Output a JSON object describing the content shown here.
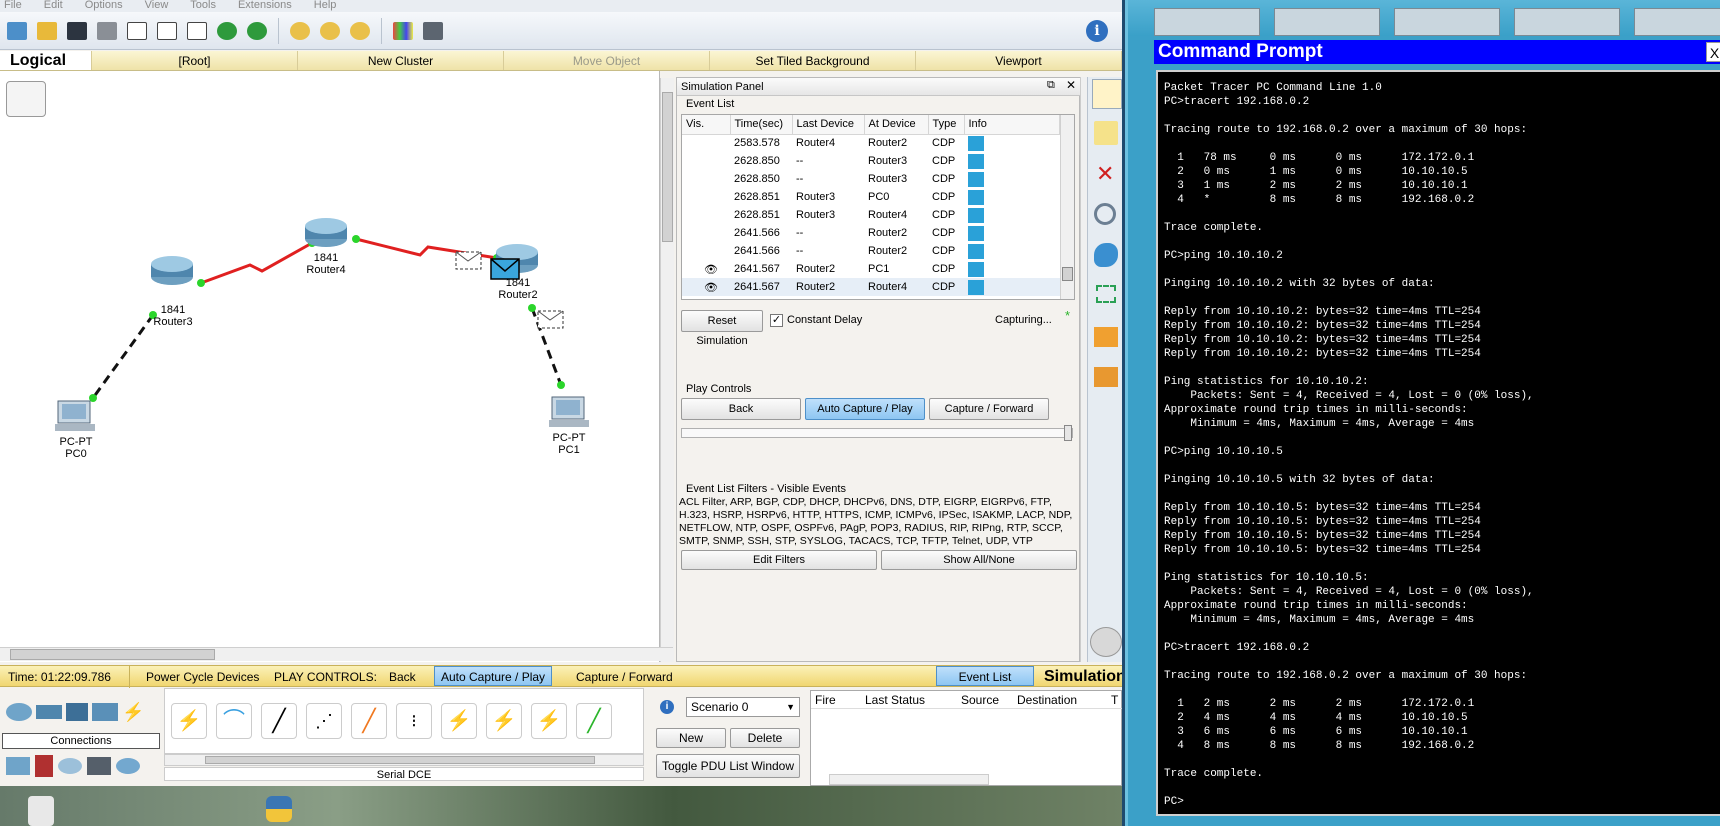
{
  "menu": [
    "File",
    "Edit",
    "Options",
    "View",
    "Tools",
    "Extensions",
    "Help"
  ],
  "logical_bar": {
    "title": "Logical",
    "items": [
      "[Root]",
      "New Cluster",
      "Move Object",
      "Set Tiled Background",
      "Viewport"
    ]
  },
  "devices": {
    "router3": {
      "model": "1841",
      "name": "Router3"
    },
    "router4": {
      "model": "1841",
      "name": "Router4"
    },
    "router2": {
      "model": "1841",
      "name": "Router2"
    },
    "pc0": {
      "model": "PC-PT",
      "name": "PC0"
    },
    "pc1": {
      "model": "PC-PT",
      "name": "PC1"
    }
  },
  "sim_panel": {
    "title": "Simulation Panel",
    "event_list_label": "Event List",
    "columns": [
      "Vis.",
      "Time(sec)",
      "Last Device",
      "At Device",
      "Type",
      "Info"
    ],
    "rows": [
      {
        "vis": "",
        "time": "2583.578",
        "last": "Router4",
        "at": "Router2",
        "type": "CDP"
      },
      {
        "vis": "",
        "time": "2628.850",
        "last": "--",
        "at": "Router3",
        "type": "CDP"
      },
      {
        "vis": "",
        "time": "2628.850",
        "last": "--",
        "at": "Router3",
        "type": "CDP"
      },
      {
        "vis": "",
        "time": "2628.851",
        "last": "Router3",
        "at": "PC0",
        "type": "CDP"
      },
      {
        "vis": "",
        "time": "2628.851",
        "last": "Router3",
        "at": "Router4",
        "type": "CDP"
      },
      {
        "vis": "",
        "time": "2641.566",
        "last": "--",
        "at": "Router2",
        "type": "CDP"
      },
      {
        "vis": "",
        "time": "2641.566",
        "last": "--",
        "at": "Router2",
        "type": "CDP"
      },
      {
        "vis": "eye",
        "time": "2641.567",
        "last": "Router2",
        "at": "PC1",
        "type": "CDP"
      },
      {
        "vis": "eye",
        "time": "2641.567",
        "last": "Router2",
        "at": "Router4",
        "type": "CDP"
      }
    ],
    "info_color": "#2aa1d8",
    "reset_label": "Reset Simulation",
    "constant_delay_label": "Constant Delay",
    "capturing_label": "Capturing...",
    "play_controls_label": "Play Controls",
    "back_label": "Back",
    "auto_label": "Auto Capture / Play",
    "forward_label": "Capture / Forward",
    "filters_label": "Event List Filters - Visible Events",
    "filters_text": "ACL Filter, ARP, BGP, CDP, DHCP, DHCPv6, DNS, DTP, EIGRP, EIGRPv6, FTP, H.323, HSRP, HSRPv6, HTTP, HTTPS, ICMP, ICMPv6, IPSec, ISAKMP, LACP, NDP, NETFLOW, NTP, OSPF, OSPFv6, PAgP, POP3, RADIUS, RIP, RIPng, RTP, SCCP, SMTP, SNMP, SSH, STP, SYSLOG, TACACS, TCP, TFTP, Telnet, UDP, VTP",
    "edit_filters_label": "Edit Filters",
    "show_all_label": "Show All/None"
  },
  "bottom_bar": {
    "time": "Time: 01:22:09.786",
    "power_cycle": "Power Cycle Devices",
    "play_controls": "PLAY CONTROLS:",
    "back": "Back",
    "auto": "Auto Capture / Play",
    "forward": "Capture / Forward",
    "event_list": "Event List",
    "mode": "Simulation"
  },
  "device_panel": {
    "connections_label": "Connections",
    "selected_conn": "Serial DCE",
    "scenario": "Scenario 0",
    "new_label": "New",
    "delete_label": "Delete",
    "toggle_label": "Toggle PDU List Window",
    "pdu_columns": [
      "Fire",
      "Last Status",
      "Source",
      "Destination",
      "T"
    ]
  },
  "cmd": {
    "title": "Command Prompt",
    "close": "X",
    "lines": [
      "Packet Tracer PC Command Line 1.0",
      "PC>tracert 192.168.0.2",
      "",
      "Tracing route to 192.168.0.2 over a maximum of 30 hops:",
      "",
      "  1   78 ms     0 ms      0 ms      172.172.0.1",
      "  2   0 ms      1 ms      0 ms      10.10.10.5",
      "  3   1 ms      2 ms      2 ms      10.10.10.1",
      "  4   *         8 ms      8 ms      192.168.0.2",
      "",
      "Trace complete.",
      "",
      "PC>ping 10.10.10.2",
      "",
      "Pinging 10.10.10.2 with 32 bytes of data:",
      "",
      "Reply from 10.10.10.2: bytes=32 time=4ms TTL=254",
      "Reply from 10.10.10.2: bytes=32 time=4ms TTL=254",
      "Reply from 10.10.10.2: bytes=32 time=4ms TTL=254",
      "Reply from 10.10.10.2: bytes=32 time=4ms TTL=254",
      "",
      "Ping statistics for 10.10.10.2:",
      "    Packets: Sent = 4, Received = 4, Lost = 0 (0% loss),",
      "Approximate round trip times in milli-seconds:",
      "    Minimum = 4ms, Maximum = 4ms, Average = 4ms",
      "",
      "PC>ping 10.10.10.5",
      "",
      "Pinging 10.10.10.5 with 32 bytes of data:",
      "",
      "Reply from 10.10.10.5: bytes=32 time=4ms TTL=254",
      "Reply from 10.10.10.5: bytes=32 time=4ms TTL=254",
      "Reply from 10.10.10.5: bytes=32 time=4ms TTL=254",
      "Reply from 10.10.10.5: bytes=32 time=4ms TTL=254",
      "",
      "Ping statistics for 10.10.10.5:",
      "    Packets: Sent = 4, Received = 4, Lost = 0 (0% loss),",
      "Approximate round trip times in milli-seconds:",
      "    Minimum = 4ms, Maximum = 4ms, Average = 4ms",
      "",
      "PC>tracert 192.168.0.2",
      "",
      "Tracing route to 192.168.0.2 over a maximum of 30 hops:",
      "",
      "  1   2 ms      2 ms      2 ms      172.172.0.1",
      "  2   4 ms      4 ms      4 ms      10.10.10.5",
      "  3   6 ms      6 ms      6 ms      10.10.10.1",
      "  4   8 ms      8 ms      8 ms      192.168.0.2",
      "",
      "Trace complete.",
      "",
      "PC>"
    ]
  }
}
